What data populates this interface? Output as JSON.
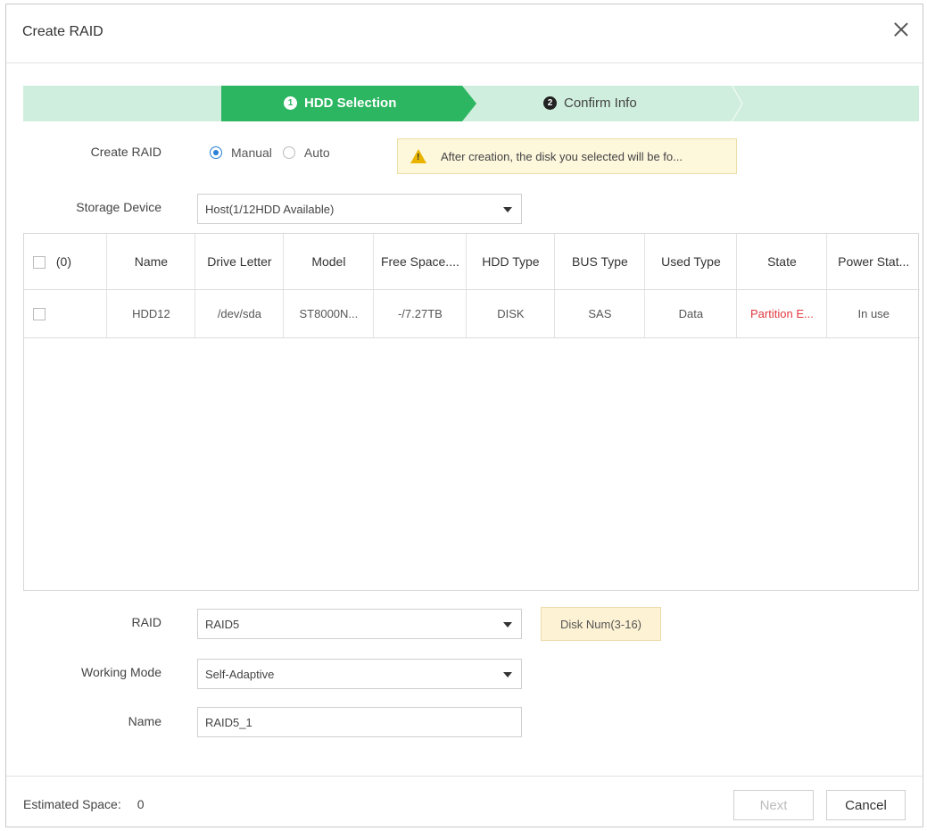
{
  "dialog": {
    "title": "Create RAID"
  },
  "stepper": {
    "steps": [
      {
        "num": "1",
        "label": "HDD Selection"
      },
      {
        "num": "2",
        "label": "Confirm Info"
      }
    ],
    "active_color": "#2db661",
    "inactive_color": "#cfeedd"
  },
  "form": {
    "create_raid_label": "Create RAID",
    "mode_options": [
      "Manual",
      "Auto"
    ],
    "mode_selected": "Manual",
    "warning_text": "After creation, the disk you selected will be fo...",
    "storage_device_label": "Storage Device",
    "storage_device_value": "Host(1/12HDD Available)"
  },
  "table": {
    "select_count": "(0)",
    "columns": [
      "Name",
      "Drive Letter",
      "Model",
      "Free Space....",
      "HDD Type",
      "BUS Type",
      "Used Type",
      "State",
      "Power Stat..."
    ],
    "rows": [
      {
        "name": "HDD12",
        "drive_letter": "/dev/sda",
        "model": "ST8000N...",
        "free_space": "-/7.27TB",
        "hdd_type": "DISK",
        "bus_type": "SAS",
        "used_type": "Data",
        "state": "Partition E...",
        "power_state": "In use"
      }
    ]
  },
  "raid": {
    "raid_label": "RAID",
    "raid_value": "RAID5",
    "disk_hint": "Disk Num(3-16)",
    "working_mode_label": "Working Mode",
    "working_mode_value": "Self-Adaptive",
    "name_label": "Name",
    "name_value": "RAID5_1"
  },
  "footer": {
    "estimated_label": "Estimated Space:",
    "estimated_value": "0",
    "next_label": "Next",
    "cancel_label": "Cancel"
  },
  "colors": {
    "accent": "#2db661",
    "radio": "#2a7fd6",
    "state_error": "#e0393e"
  }
}
